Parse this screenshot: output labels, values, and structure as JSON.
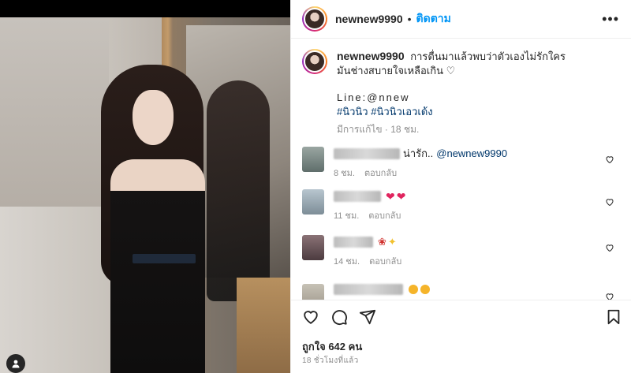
{
  "post": {
    "username": "newnew9990",
    "separator": "•",
    "follow_label": "ติดตาม",
    "more_label": "•••"
  },
  "caption": {
    "username": "newnew9990",
    "text_line1": "การตื่นมาแล้วพบว่าตัวเองไม่รักใคร",
    "text_line2": "มันช่างสบายใจเหลือเกิน ♡",
    "line_id": "Line:@nnew",
    "hashtag1": "#นิวนิว",
    "hashtag2": "#นิวนิวเอวเด้ง",
    "edited": "มีการแก้ไข · 18 ชม."
  },
  "comments": [
    {
      "text": "น่ารัก..",
      "mention": "@newnew9990",
      "time": "8 ชม.",
      "reply_label": "ตอบกลับ",
      "emoji": ""
    },
    {
      "text": "",
      "mention": "",
      "time": "11 ชม.",
      "reply_label": "ตอบกลับ",
      "emoji": "hearts"
    },
    {
      "text": "",
      "mention": "",
      "time": "14 ชม.",
      "reply_label": "ตอบกลับ",
      "emoji": "rose-sparkle"
    },
    {
      "text": "",
      "mention": "",
      "time": "",
      "reply_label": "",
      "emoji": "faces"
    }
  ],
  "footer": {
    "likes": "ถูกใจ 642 คน",
    "timestamp": "18 ชั่วโมงที่แล้ว"
  },
  "colors": {
    "accent": "#0095f6",
    "hashtag": "#00376b",
    "meta": "#8e8e8e"
  },
  "icons": [
    "heart-icon",
    "comment-icon",
    "share-icon",
    "bookmark-icon",
    "more-icon",
    "user-tag-icon"
  ]
}
